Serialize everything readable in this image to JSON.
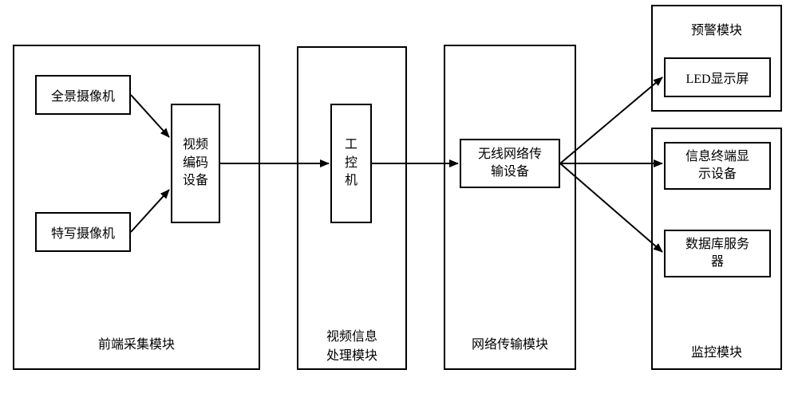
{
  "modules": {
    "acquisition": {
      "label": "前端采集模块"
    },
    "processing": {
      "label": "视频信息处理模块",
      "label_l1": "视频信息",
      "label_l2": "处理模块"
    },
    "network": {
      "label": "网络传输模块"
    },
    "warning": {
      "label": "预警模块"
    },
    "monitor": {
      "label": "监控模块"
    }
  },
  "boxes": {
    "panoramic_camera": {
      "label": "全景摄像机"
    },
    "closeup_camera": {
      "label": "特写摄像机"
    },
    "video_encoder": {
      "l1": "视频",
      "l2": "编码",
      "l3": "设备"
    },
    "ipc": {
      "l1": "工",
      "l2": "控",
      "l3": "机"
    },
    "wireless": {
      "l1": "无线网络传",
      "l2": "输设备"
    },
    "led": {
      "label": "LED显示屏"
    },
    "terminal": {
      "l1": "信息终端显",
      "l2": "示设备"
    },
    "db": {
      "l1": "数据库服务",
      "l2": "器"
    }
  }
}
